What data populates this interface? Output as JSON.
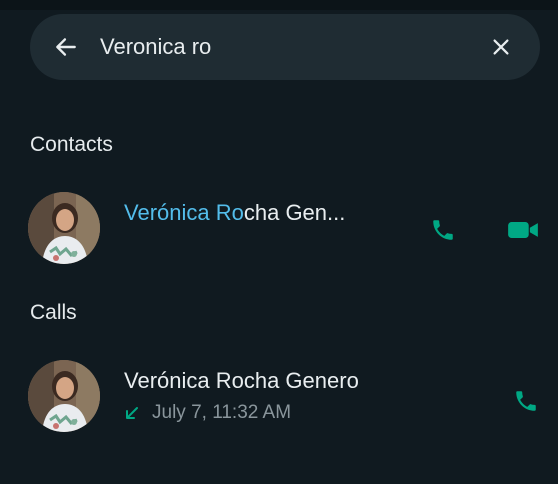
{
  "search": {
    "value": "Veronica ro",
    "back_icon": "arrow-left-icon",
    "clear_icon": "close-icon"
  },
  "sections": {
    "contacts_title": "Contacts",
    "calls_title": "Calls"
  },
  "contacts": [
    {
      "name_match": "Verónica Ro",
      "name_rest": "cha Gen...",
      "voice_icon": "phone-icon",
      "video_icon": "video-camera-icon"
    }
  ],
  "calls": [
    {
      "name": "Verónica Rocha Genero",
      "direction_icon": "incoming-arrow-icon",
      "time": "July 7, 11:32 AM",
      "voice_icon": "phone-icon"
    }
  ],
  "colors": {
    "background": "#101a20",
    "search_bar": "#1f2c33",
    "accent_green": "#00a884",
    "highlight_blue": "#53bdeb",
    "secondary_text": "#8a969c"
  }
}
